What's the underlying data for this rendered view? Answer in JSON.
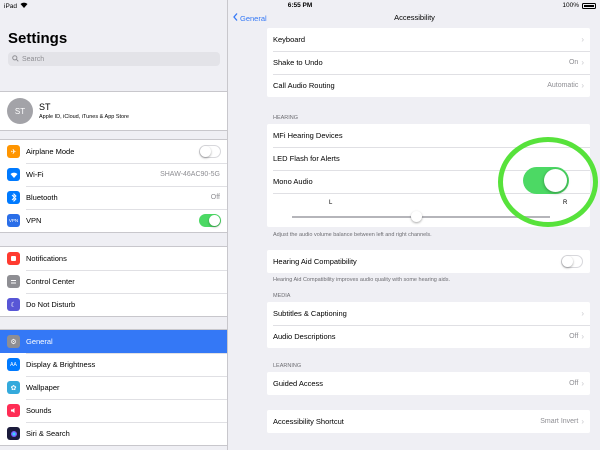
{
  "status_bar": {
    "device": "iPad",
    "time": "6:55 PM",
    "battery": "100%"
  },
  "master": {
    "title": "Settings",
    "search_placeholder": "Search",
    "profile": {
      "initials": "ST",
      "name": "ST",
      "subtitle": "Apple ID, iCloud, iTunes & App Store"
    },
    "group1": [
      {
        "label": "Airplane Mode",
        "icon": "airplane-icon",
        "color": "#ff9500",
        "toggle": false
      },
      {
        "label": "Wi-Fi",
        "icon": "wifi-icon",
        "color": "#007aff",
        "value": "SHAW-46AC90-5G"
      },
      {
        "label": "Bluetooth",
        "icon": "bluetooth-icon",
        "color": "#007aff",
        "value": "Off"
      },
      {
        "label": "VPN",
        "icon": "vpn-icon",
        "icon_text": "VPN",
        "color": "#2a6ee8",
        "toggle": true
      }
    ],
    "group2": [
      {
        "label": "Notifications",
        "icon": "notifications-icon",
        "color": "#ff3b30"
      },
      {
        "label": "Control Center",
        "icon": "control-center-icon",
        "color": "#8e8e93"
      },
      {
        "label": "Do Not Disturb",
        "icon": "moon-icon",
        "color": "#5856d6"
      }
    ],
    "group3": [
      {
        "label": "General",
        "icon": "gear-icon",
        "color": "#8e8e93",
        "selected": true
      },
      {
        "label": "Display & Brightness",
        "icon": "display-icon",
        "icon_text": "AA",
        "color": "#007aff"
      },
      {
        "label": "Wallpaper",
        "icon": "wallpaper-icon",
        "color": "#34aadc"
      },
      {
        "label": "Sounds",
        "icon": "sounds-icon",
        "color": "#ff2d55"
      },
      {
        "label": "Siri & Search",
        "icon": "siri-icon",
        "color": "#1c1c3c"
      }
    ]
  },
  "detail": {
    "back_label": "General",
    "title": "Accessibility",
    "group_top": [
      {
        "label": "Keyboard"
      },
      {
        "label": "Shake to Undo",
        "value": "On"
      },
      {
        "label": "Call Audio Routing",
        "value": "Automatic"
      }
    ],
    "hearing_header": "HEARING",
    "hearing": [
      {
        "label": "MFi Hearing Devices"
      },
      {
        "label": "LED Flash for Alerts"
      },
      {
        "label": "Mono Audio"
      }
    ],
    "balance": {
      "left": "L",
      "right": "R",
      "level": 0.5
    },
    "balance_footer": "Adjust the audio volume balance between left and right channels.",
    "hac_label": "Hearing Aid Compatibility",
    "hac_footer": "Hearing Aid Compatibility improves audio quality with some hearing aids.",
    "media_header": "MEDIA",
    "media": [
      {
        "label": "Subtitles & Captioning"
      },
      {
        "label": "Audio Descriptions",
        "value": "Off"
      }
    ],
    "learning_header": "LEARNING",
    "guided_access": {
      "label": "Guided Access",
      "value": "Off"
    },
    "shortcut": {
      "label": "Accessibility Shortcut",
      "value": "Smart Invert"
    }
  }
}
